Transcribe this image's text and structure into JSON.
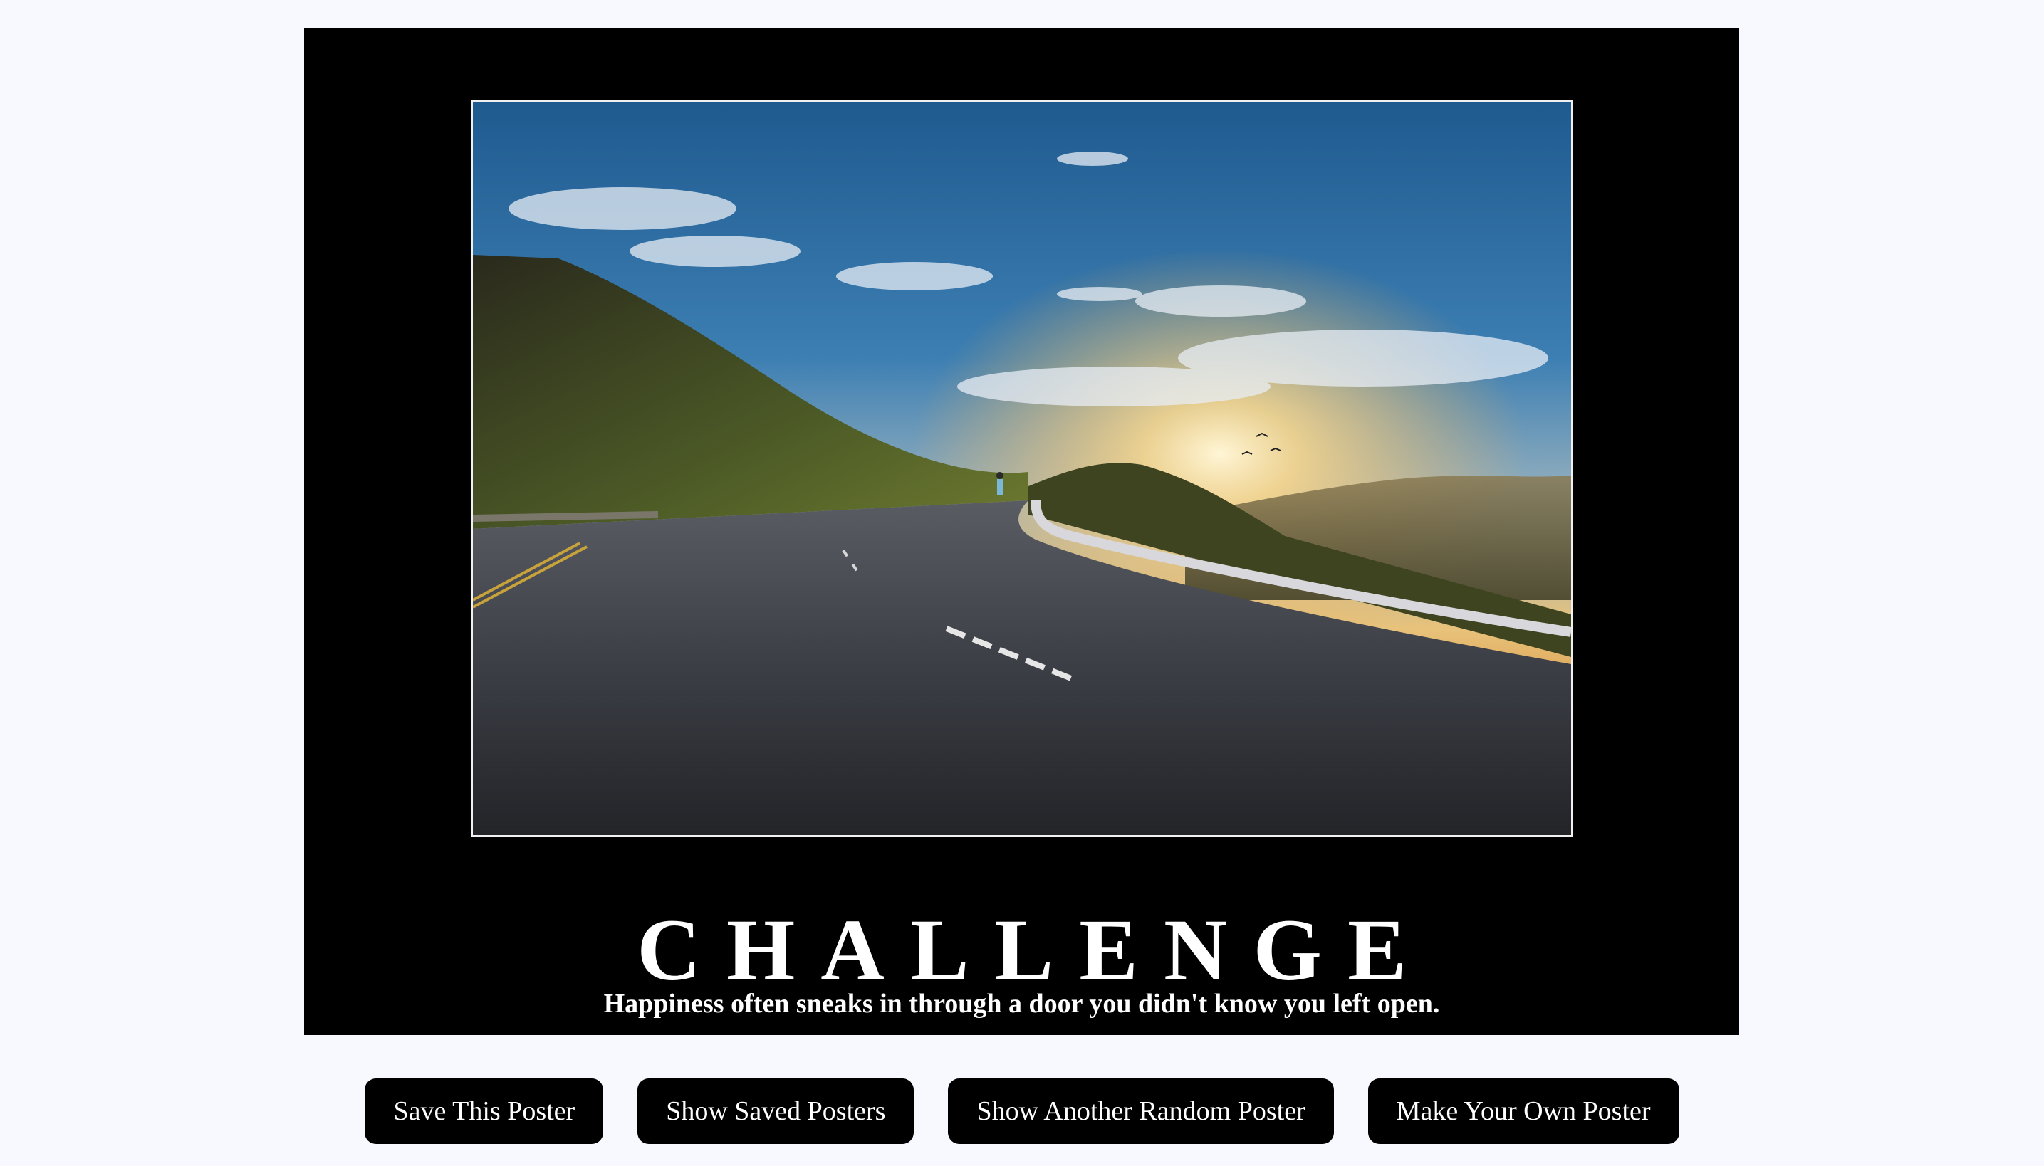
{
  "poster": {
    "title": "CHALLENGE",
    "quote": "Happiness often sneaks in through a door you didn't know you left open."
  },
  "buttons": {
    "save": "Save This Poster",
    "show_saved": "Show Saved Posters",
    "random": "Show Another Random Poster",
    "make_own": "Make Your Own Poster"
  },
  "colors": {
    "page_background": "#f8f8ff",
    "poster_background": "#000000",
    "button_background": "#000000",
    "button_text": "#ffffff"
  }
}
